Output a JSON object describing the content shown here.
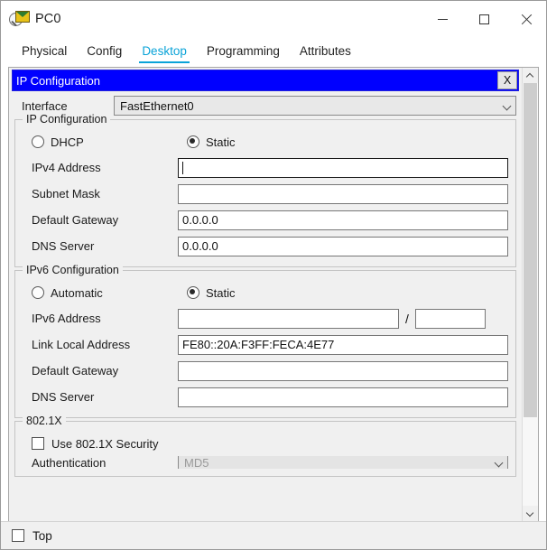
{
  "window": {
    "title": "PC0",
    "icon": "packet-tracer-pc-icon",
    "minimize_label": "Minimize",
    "maximize_label": "Maximize",
    "close_label": "Close"
  },
  "tabs": [
    {
      "label": "Physical",
      "active": false
    },
    {
      "label": "Config",
      "active": false
    },
    {
      "label": "Desktop",
      "active": true
    },
    {
      "label": "Programming",
      "active": false
    },
    {
      "label": "Attributes",
      "active": false
    }
  ],
  "dialog": {
    "title": "IP Configuration",
    "close_label": "X",
    "accent_color": "#0000FF"
  },
  "interface": {
    "label": "Interface",
    "value": "FastEthernet0"
  },
  "ipv4": {
    "group_title": "IP Configuration",
    "mode_dhcp_label": "DHCP",
    "mode_static_label": "Static",
    "mode_selected": "Static",
    "fields": [
      {
        "label": "IPv4 Address",
        "value": "",
        "focused": true
      },
      {
        "label": "Subnet Mask",
        "value": "",
        "focused": false
      },
      {
        "label": "Default Gateway",
        "value": "0.0.0.0",
        "focused": false
      },
      {
        "label": "DNS Server",
        "value": "0.0.0.0",
        "focused": false
      }
    ]
  },
  "ipv6": {
    "group_title": "IPv6 Configuration",
    "mode_auto_label": "Automatic",
    "mode_static_label": "Static",
    "mode_selected": "Static",
    "address_label": "IPv6 Address",
    "address_value": "",
    "prefix_separator": "/",
    "prefix_value": "",
    "link_local_label": "Link Local Address",
    "link_local_value": "FE80::20A:F3FF:FECA:4E77",
    "gateway_label": "Default Gateway",
    "gateway_value": "",
    "dns_label": "DNS Server",
    "dns_value": ""
  },
  "dot1x": {
    "group_title": "802.1X",
    "use_security_label": "Use 802.1X Security",
    "use_security_checked": false,
    "authentication_label": "Authentication",
    "authentication_value": "MD5"
  },
  "bottom": {
    "top_label": "Top",
    "top_checked": false
  },
  "scrollbar": {
    "up_arrow": "scroll-up-icon",
    "down_arrow": "scroll-down-icon"
  }
}
